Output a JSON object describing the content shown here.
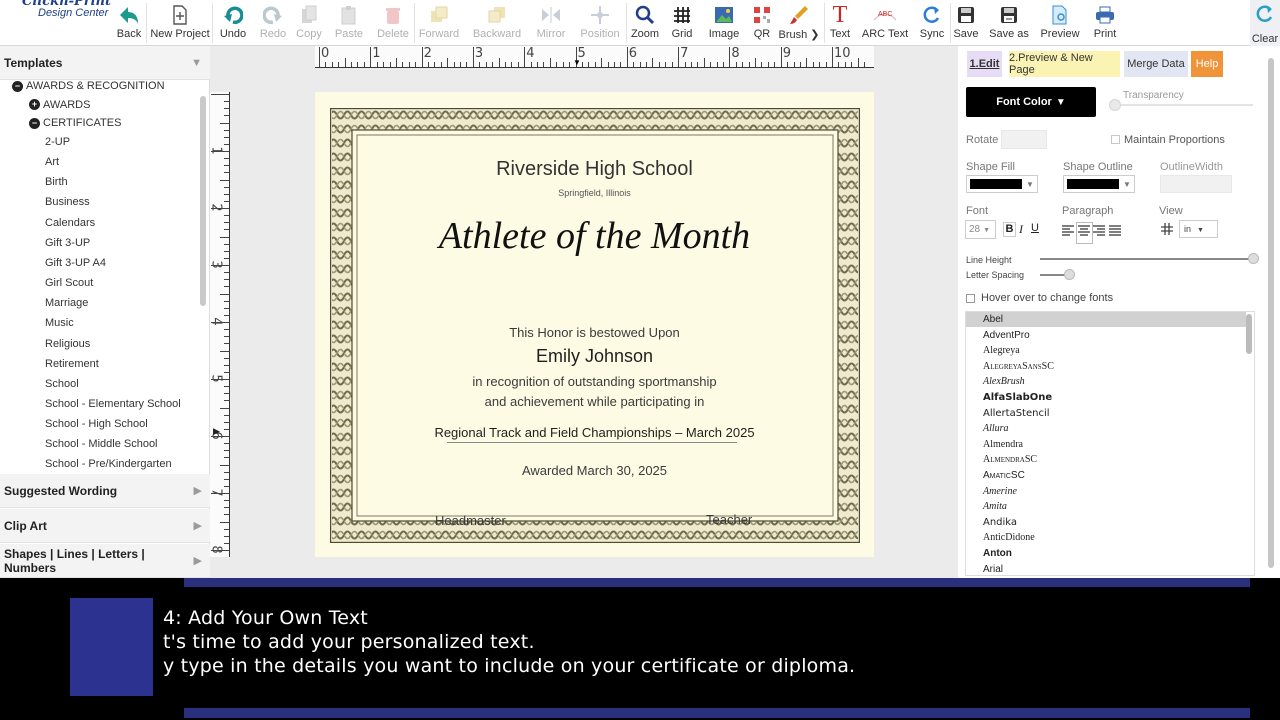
{
  "logo": {
    "line1": "Clickn-Print",
    "line2": "Design Center"
  },
  "toolbar": [
    {
      "id": "back",
      "label": "Back",
      "icon": "arrow-left-icon",
      "enabled": true
    },
    {
      "id": "new-project",
      "label": "New Project",
      "icon": "new-document-icon",
      "enabled": true
    },
    {
      "id": "undo",
      "label": "Undo",
      "icon": "undo-icon",
      "enabled": true
    },
    {
      "id": "redo",
      "label": "Redo",
      "icon": "redo-icon",
      "enabled": false
    },
    {
      "id": "copy",
      "label": "Copy",
      "icon": "copy-icon",
      "enabled": false
    },
    {
      "id": "paste",
      "label": "Paste",
      "icon": "paste-icon",
      "enabled": false
    },
    {
      "id": "delete",
      "label": "Delete",
      "icon": "trash-icon",
      "enabled": false
    },
    {
      "id": "forward",
      "label": "Forward",
      "icon": "bring-forward-icon",
      "enabled": false
    },
    {
      "id": "backward",
      "label": "Backward",
      "icon": "send-backward-icon",
      "enabled": false
    },
    {
      "id": "mirror",
      "label": "Mirror",
      "icon": "mirror-icon",
      "enabled": false
    },
    {
      "id": "position",
      "label": "Position",
      "icon": "position-icon",
      "enabled": false
    },
    {
      "id": "zoom",
      "label": "Zoom",
      "icon": "magnifier-icon",
      "enabled": true
    },
    {
      "id": "grid",
      "label": "Grid",
      "icon": "grid-icon",
      "enabled": true
    },
    {
      "id": "image",
      "label": "Image",
      "icon": "image-icon",
      "enabled": true
    },
    {
      "id": "qr",
      "label": "QR",
      "icon": "qr-code-icon",
      "enabled": true
    },
    {
      "id": "brush",
      "label": "Brush ❯",
      "icon": "brush-icon",
      "enabled": true
    },
    {
      "id": "text",
      "label": "Text",
      "icon": "text-icon",
      "enabled": true
    },
    {
      "id": "arc-text",
      "label": "ARC Text",
      "icon": "arc-text-icon",
      "enabled": true
    },
    {
      "id": "sync",
      "label": "Sync",
      "icon": "sync-icon",
      "enabled": true
    },
    {
      "id": "save",
      "label": "Save",
      "icon": "floppy-icon",
      "enabled": true
    },
    {
      "id": "save-as",
      "label": "Save as",
      "icon": "floppy-as-icon",
      "enabled": true
    },
    {
      "id": "preview",
      "label": "Preview",
      "icon": "preview-icon",
      "enabled": true
    },
    {
      "id": "print",
      "label": "Print",
      "icon": "printer-icon",
      "enabled": true
    }
  ],
  "clear_label": "Clear",
  "sidebar": {
    "templates_title": "Templates",
    "tree": [
      {
        "label": "AWARDS & RECOGNITION",
        "level": 0,
        "toggle": "−"
      },
      {
        "label": "AWARDS",
        "level": 1,
        "toggle": "+"
      },
      {
        "label": "CERTIFICATES",
        "level": 1,
        "toggle": "−"
      },
      {
        "label": "2-UP",
        "level": 2
      },
      {
        "label": "Art",
        "level": 2
      },
      {
        "label": "Birth",
        "level": 2
      },
      {
        "label": "Business",
        "level": 2
      },
      {
        "label": "Calendars",
        "level": 2
      },
      {
        "label": "Gift 3-UP",
        "level": 2
      },
      {
        "label": "Gift 3-UP A4",
        "level": 2
      },
      {
        "label": "Girl Scout",
        "level": 2
      },
      {
        "label": "Marriage",
        "level": 2
      },
      {
        "label": "Music",
        "level": 2
      },
      {
        "label": "Religious",
        "level": 2
      },
      {
        "label": "Retirement",
        "level": 2
      },
      {
        "label": "School",
        "level": 2
      },
      {
        "label": "School - Elementary School",
        "level": 2
      },
      {
        "label": "School - High School",
        "level": 2
      },
      {
        "label": "School - Middle School",
        "level": 2
      },
      {
        "label": "School - Pre/Kindergarten",
        "level": 2
      }
    ],
    "sections": [
      "Suggested Wording",
      "Clip Art",
      "Shapes | Lines | Letters | Numbers"
    ]
  },
  "ruler": {
    "h_numbers": [
      "0",
      "1",
      "2",
      "3",
      "4",
      "5",
      "6",
      "7",
      "8",
      "9",
      "10"
    ],
    "v_numbers": [
      "1",
      "2",
      "3",
      "4",
      "5",
      "6",
      "7",
      "8"
    ]
  },
  "certificate": {
    "school": "Riverside High School",
    "location": "Springfield, Illinois",
    "title": "Athlete of the Month",
    "bestowed": "This Honor is bestowed Upon",
    "recipient": "Emily Johnson",
    "recognition_1": "in recognition of outstanding sportmanship",
    "recognition_2": "and achievement while participating in",
    "event": "Regional Track and Field Championships – March 2025",
    "awarded": "Awarded March 30, 2025",
    "sig_left": "Headmaster",
    "sig_right": "Teacher"
  },
  "rpanel": {
    "tabs": [
      {
        "label": "1.Edit",
        "bg": "#e6dcf5",
        "active": true
      },
      {
        "label": "2.Preview & New Page",
        "bg": "#fbf3b4",
        "active": false
      },
      {
        "label": "Merge Data",
        "bg": "#e2e6f3",
        "active": false
      },
      {
        "label": "Help",
        "bg": "#f0943a",
        "active": false
      }
    ],
    "font_color_label": "Font Color",
    "transparency_label": "Transparency",
    "rotate_label": "Rotate",
    "maintain_label": "Maintain Proportions",
    "shape_fill_label": "Shape Fill",
    "shape_outline_label": "Shape Outline",
    "outline_width_label": "OutlineWidth",
    "font_label": "Font",
    "font_size": "28",
    "paragraph_label": "Paragraph",
    "view_label": "View",
    "view_unit": "in",
    "line_height_label": "Line Height",
    "letter_spacing_label": "Letter Spacing",
    "hover_label": "Hover over to change fonts",
    "fonts": [
      {
        "name": "Abel",
        "family": "Liberation Sans",
        "style": "normal",
        "weight": "normal",
        "selected": true
      },
      {
        "name": "AdventPro",
        "family": "Liberation Sans",
        "style": "normal",
        "weight": "normal"
      },
      {
        "name": "Alegreya",
        "family": "Liberation Serif",
        "style": "normal",
        "weight": "normal"
      },
      {
        "name": "AlegreyaSansSC",
        "family": "Liberation Serif",
        "style": "normal",
        "weight": "normal",
        "smallcaps": true
      },
      {
        "name": "AlexBrush",
        "family": "Liberation Serif",
        "style": "italic",
        "weight": "normal"
      },
      {
        "name": "AlfaSlabOne",
        "family": "DejaVu Sans",
        "style": "normal",
        "weight": "bold"
      },
      {
        "name": "AllertaStencil",
        "family": "DejaVu Sans",
        "style": "normal",
        "weight": "normal"
      },
      {
        "name": "Allura",
        "family": "Liberation Serif",
        "style": "italic",
        "weight": "normal"
      },
      {
        "name": "Almendra",
        "family": "Liberation Serif",
        "style": "normal",
        "weight": "normal"
      },
      {
        "name": "AlmendraSC",
        "family": "Liberation Serif",
        "style": "normal",
        "weight": "normal",
        "smallcaps": true
      },
      {
        "name": "AmaticSC",
        "family": "Liberation Sans",
        "style": "normal",
        "weight": "normal",
        "smallcaps": true
      },
      {
        "name": "Amerine",
        "family": "Liberation Serif",
        "style": "italic",
        "weight": "normal"
      },
      {
        "name": "Amita",
        "family": "Liberation Serif",
        "style": "italic",
        "weight": "normal"
      },
      {
        "name": "Andika",
        "family": "DejaVu Sans",
        "style": "normal",
        "weight": "normal"
      },
      {
        "name": "AnticDidone",
        "family": "Liberation Serif",
        "style": "normal",
        "weight": "normal"
      },
      {
        "name": "Anton",
        "family": "Liberation Sans",
        "style": "normal",
        "weight": "bold"
      },
      {
        "name": "Arial",
        "family": "Liberation Sans",
        "style": "normal",
        "weight": "normal"
      }
    ]
  },
  "caption": {
    "line1": "4: Add Your Own Text",
    "line2": "t's time to add your personalized text.",
    "line3": "y type in the details you want to include on your certificate or diploma."
  }
}
